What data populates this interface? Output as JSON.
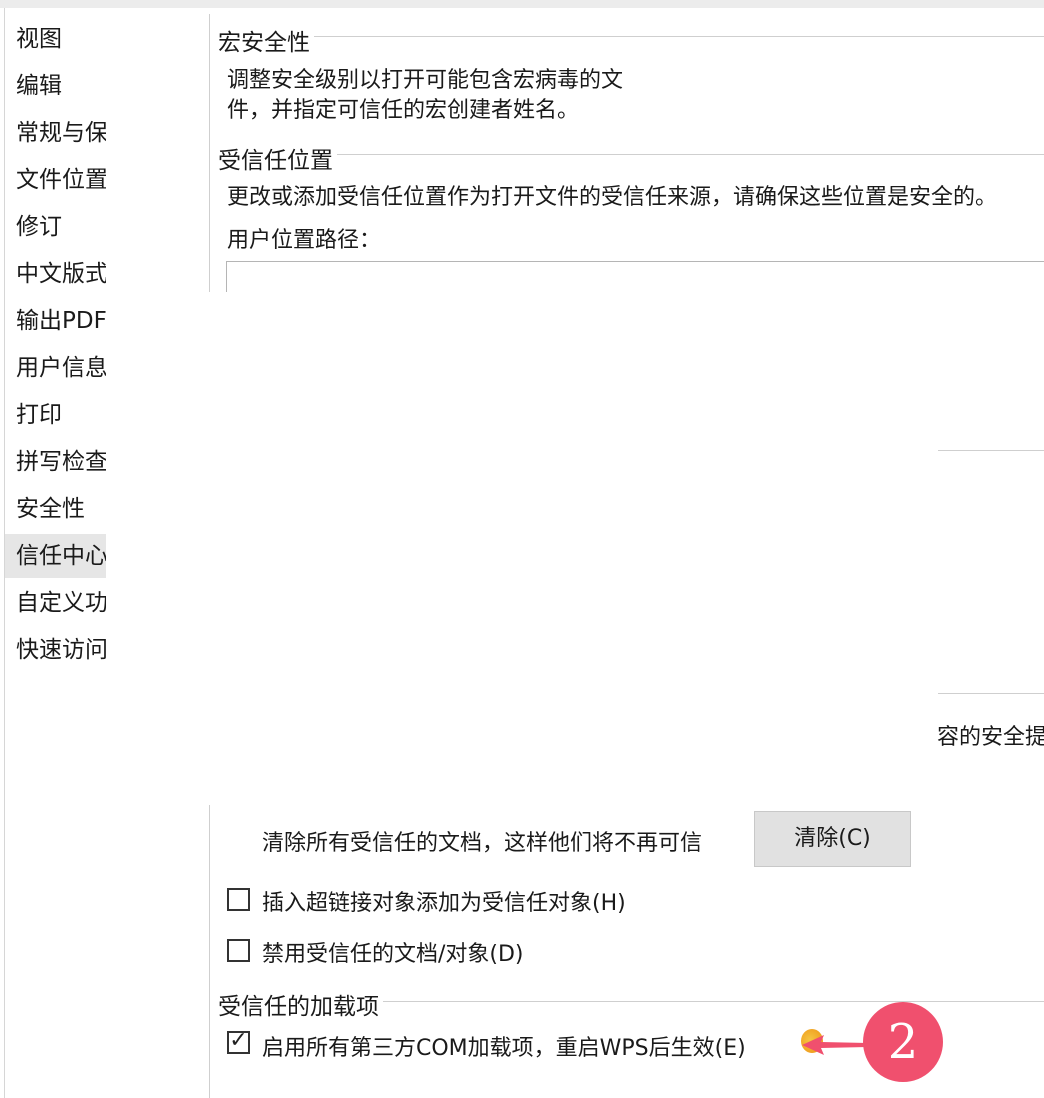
{
  "sidebar": {
    "items": [
      {
        "label": "视图"
      },
      {
        "label": "编辑"
      },
      {
        "label": "常规与保存"
      },
      {
        "label": "文件位置"
      },
      {
        "label": "修订"
      },
      {
        "label": "中文版式"
      },
      {
        "label": "输出PDF"
      },
      {
        "label": "用户信息"
      },
      {
        "label": "打印"
      },
      {
        "label": "拼写检查"
      },
      {
        "label": "安全性"
      },
      {
        "label": "信任中心",
        "active": true
      },
      {
        "label": "自定义功"
      },
      {
        "label": "快速访问"
      }
    ]
  },
  "macro_security": {
    "title": "宏安全性",
    "desc_line1": "调整安全级别以打开可能包含宏病毒的文",
    "desc_line2": "件，并指定可信任的宏创建者姓名。"
  },
  "trusted_locations": {
    "title": "受信任位置",
    "desc": "更改或添加受信任位置作为打开文件的受信任来源，请确保这些位置是安全的。",
    "path_label": "用户位置路径：",
    "right_fragment": "容的安全提"
  },
  "trusted_docs": {
    "clear_label": "清除所有受信任的文档，这样他们将不再可信",
    "clear_button": "清除(C)",
    "hyperlink_checkbox": {
      "label": "插入超链接对象添加为受信任对象(H)",
      "checked": false
    },
    "disable_checkbox": {
      "label": "禁用受信任的文档/对象(D)",
      "checked": false
    }
  },
  "trusted_addins": {
    "title": "受信任的加载项",
    "com_checkbox": {
      "label": "启用所有第三方COM加载项，重启WPS后生效(E)",
      "checked": true
    }
  },
  "annotation": {
    "badge_number": "2"
  },
  "colors": {
    "badge": "#f0506e",
    "active_nav": "#e6e6e6",
    "button": "#e1e1e1"
  }
}
